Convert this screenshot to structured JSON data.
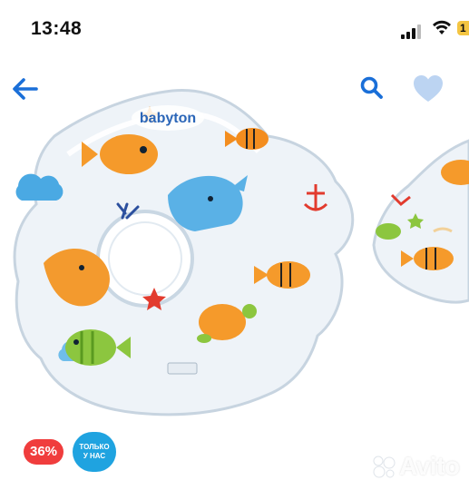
{
  "status_bar": {
    "time": "13:48",
    "battery_level": "1",
    "icons": [
      "signal-icon",
      "wifi-icon",
      "battery-icon"
    ]
  },
  "nav": {
    "icons": [
      "back-arrow-icon",
      "search-icon",
      "heart-icon"
    ],
    "accent_color": "#1a6fd8",
    "heart_color": "#bcd4f2"
  },
  "product_image": {
    "brand_text": "babyton"
  },
  "badges": {
    "discount": "36%",
    "exclusive": "ТОЛЬКО\nУ НАС",
    "discount_color": "#f03d3d",
    "exclusive_color": "#1fa3e0"
  },
  "watermark": {
    "text": "Avito"
  }
}
